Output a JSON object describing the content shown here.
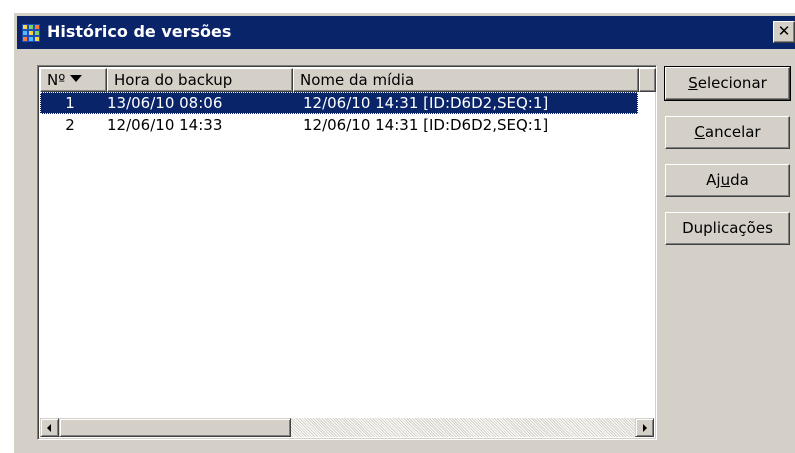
{
  "window": {
    "title": "Histórico de versões",
    "close_glyph": "✕"
  },
  "list": {
    "columns": [
      {
        "label": "Nº",
        "sorted": "descending"
      },
      {
        "label": "Hora do backup"
      },
      {
        "label": "Nome da mídia"
      }
    ],
    "rows": [
      {
        "num": "1",
        "time": "13/06/10 08:06",
        "media": "12/06/10 14:31 [ID:D6D2,SEQ:1]",
        "selected": true
      },
      {
        "num": "2",
        "time": "12/06/10 14:33",
        "media": "12/06/10 14:31 [ID:D6D2,SEQ:1]",
        "selected": false
      }
    ]
  },
  "buttons": {
    "select_pre": "",
    "select_u": "S",
    "select_post": "elecionar",
    "cancel_pre": "",
    "cancel_u": "C",
    "cancel_post": "ancelar",
    "help_pre": "Aj",
    "help_u": "u",
    "help_post": "da",
    "dup_label": "Duplicações"
  },
  "colors": {
    "titlebar": "#0a246a",
    "selection": "#0a246a",
    "face": "#d4d0c8"
  },
  "icons": {
    "app": "grid-app-icon",
    "close": "close-icon",
    "sort": "sort-down-arrow-icon",
    "scroll_left": "arrow-left-icon",
    "scroll_right": "arrow-right-icon"
  }
}
